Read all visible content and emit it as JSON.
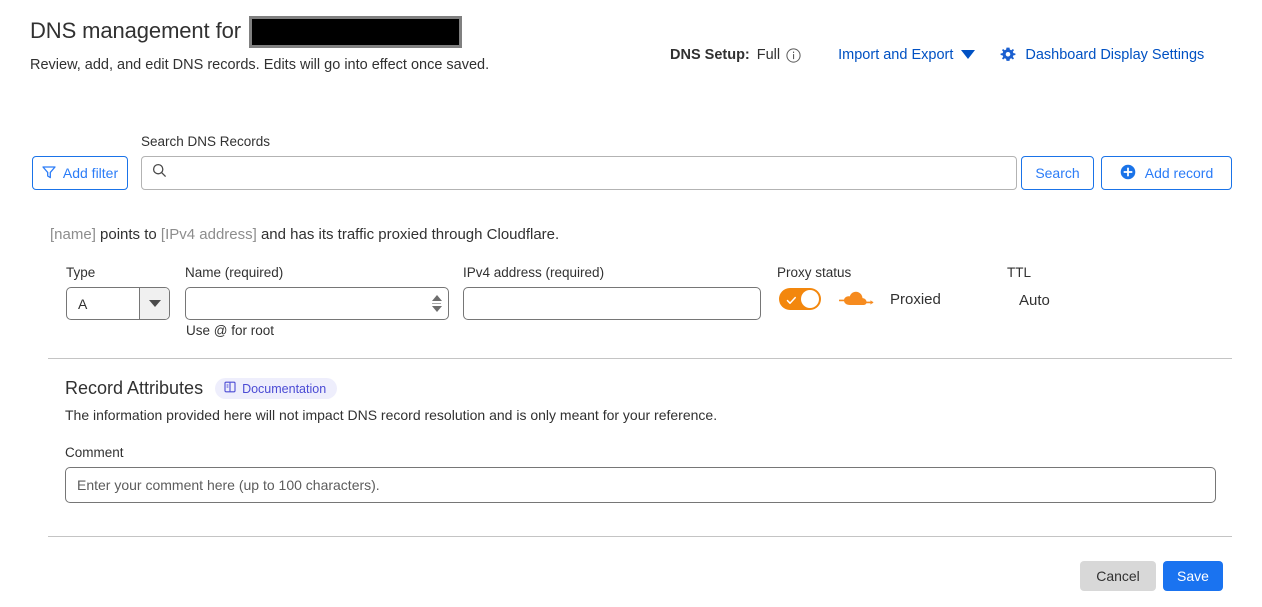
{
  "header": {
    "title": "DNS management for",
    "redacted_domain": "",
    "subtitle": "Review, add, and edit DNS records. Edits will go into effect once saved.",
    "dns_setup_label": "DNS Setup:",
    "dns_setup_value": "Full",
    "info_icon": "info-circle-icon",
    "import_export": "Import and Export",
    "caret_icon": "chevron-down-icon",
    "gear_icon": "gear-icon",
    "dashboard_display_settings": "Dashboard Display Settings",
    "link_color": "#0051c3"
  },
  "toolbar": {
    "add_filter_label": "Add filter",
    "filter_icon": "filter-funnel-icon",
    "search_label": "Search DNS Records",
    "search_icon": "search-icon",
    "search_value": "",
    "search_placeholder": "",
    "search_button_label": "Search",
    "add_record_label": "Add record",
    "add_record_icon": "plus-circle-icon",
    "accent_color": "#2b7cf7"
  },
  "record_form": {
    "summary": {
      "name_placeholder": "[name]",
      "mid_text": " points to ",
      "ipv4_placeholder": "[IPv4 address]",
      "tail_text": " and has its traffic proxied through Cloudflare."
    },
    "type": {
      "label": "Type",
      "value": "A",
      "caret_icon": "chevron-down-icon"
    },
    "name": {
      "label": "Name (required)",
      "value": "",
      "placeholder": "",
      "hint": "Use @ for root",
      "spinner_icon": "stepper-updown-icon"
    },
    "ipv4": {
      "label": "IPv4 address (required)",
      "value": "",
      "placeholder": ""
    },
    "proxy": {
      "label": "Proxy status",
      "status_text": "Proxied",
      "toggle_on": "true",
      "toggle_color": "#f3870d",
      "cloud_icon": "cloudflare-cloud-icon"
    },
    "ttl": {
      "label": "TTL",
      "value": "Auto"
    }
  },
  "record_attributes": {
    "title": "Record Attributes",
    "documentation_badge": "Documentation",
    "documentation_icon": "book-icon",
    "badge_color": "#4b4bd4",
    "description": "The information provided here will not impact DNS record resolution and is only meant for your reference.",
    "comment_label": "Comment",
    "comment_value": "",
    "comment_placeholder": "Enter your comment here (up to 100 characters)."
  },
  "footer": {
    "cancel_label": "Cancel",
    "save_label": "Save",
    "save_color": "#1a73f0"
  }
}
